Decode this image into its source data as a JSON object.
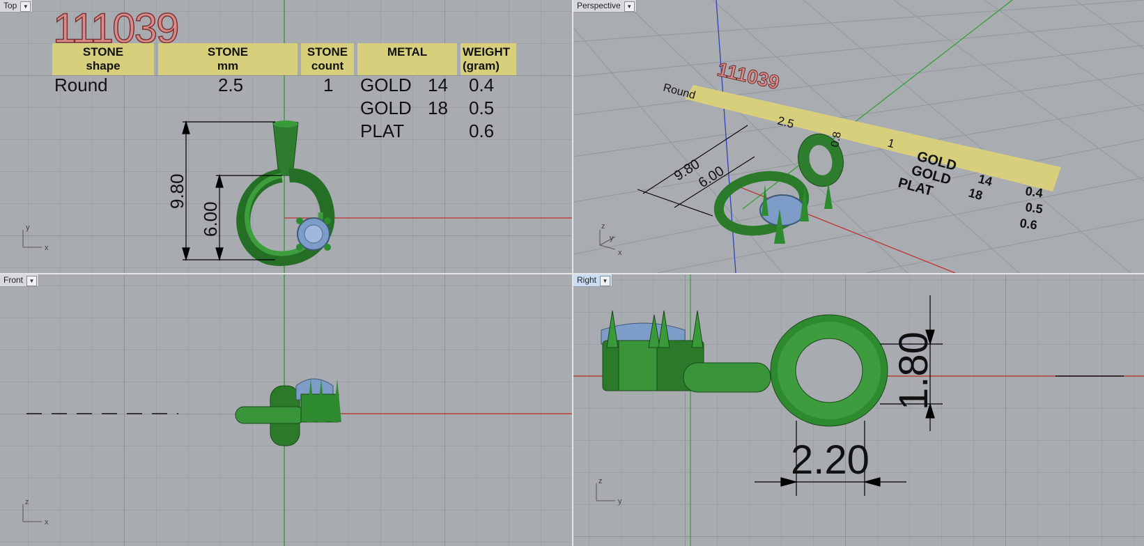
{
  "viewports": {
    "top": {
      "label": "Top"
    },
    "perspective": {
      "label": "Perspective"
    },
    "front": {
      "label": "Front"
    },
    "right": {
      "label": "Right"
    }
  },
  "model_code": "111039",
  "table": {
    "headers": [
      {
        "line1": "STONE",
        "line2": "shape"
      },
      {
        "line1": "STONE",
        "line2": "mm"
      },
      {
        "line1": "STONE",
        "line2": "count"
      },
      {
        "line1": "METAL",
        "line2": ""
      },
      {
        "line1": "WEIGHT",
        "line2": "(gram)"
      }
    ],
    "stone_shape": "Round",
    "stone_mm": "2.5",
    "stone_count": "1",
    "metals": [
      {
        "metal": "GOLD",
        "karat": "14",
        "weight": "0.4"
      },
      {
        "metal": "GOLD",
        "karat": "18",
        "weight": "0.5"
      },
      {
        "metal": "PLAT",
        "karat": "",
        "weight": "0.6"
      }
    ]
  },
  "dimensions": {
    "overall_height": "9.80",
    "ring_height": "6.00",
    "bail_height": "1.80",
    "bail_width": "2.20",
    "persp_small": "0.8"
  },
  "axes": {
    "top": {
      "h": "x",
      "v": "y"
    },
    "perspective": {
      "x": "x",
      "y": "y",
      "z": "z"
    },
    "front": {
      "h": "x",
      "v": "z"
    },
    "right": {
      "h": "y",
      "v": "z"
    }
  },
  "colors": {
    "viewport_bg": "#a8acb0",
    "metal_green": "#2e8a2e",
    "stone_blue": "#7d9cc8",
    "table_yellow": "#d8cf7c",
    "code_pink": "#d98a8a",
    "x_axis": "#c03030",
    "y_axis": "#30a030",
    "z_axis": "#3040c0"
  }
}
